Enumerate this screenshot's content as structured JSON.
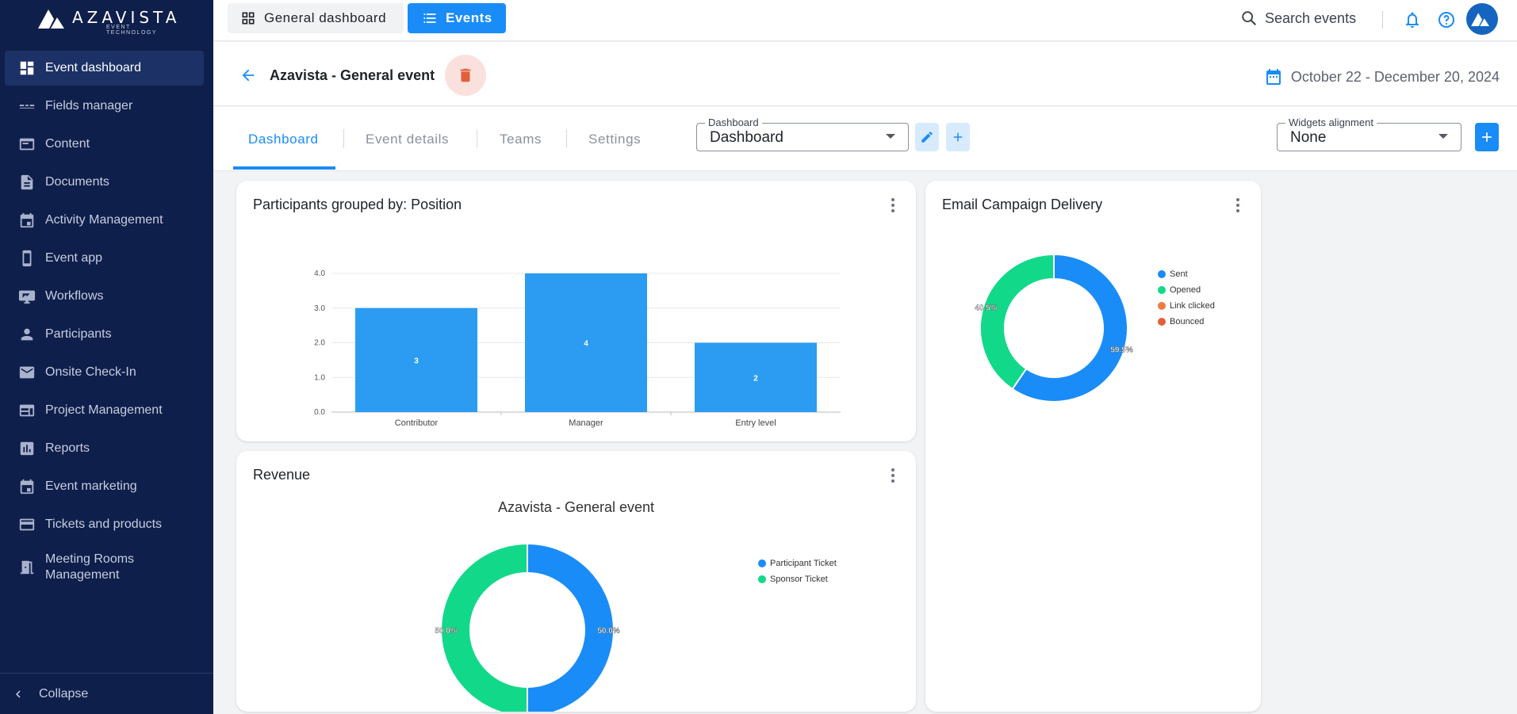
{
  "brand": {
    "name": "AZAVISTA",
    "tagline": "EVENT TECHNOLOGY"
  },
  "sidebar": {
    "items": [
      {
        "label": "Event dashboard",
        "icon": "dashboard-icon",
        "active": true
      },
      {
        "label": "Fields manager",
        "icon": "fields-icon"
      },
      {
        "label": "Content",
        "icon": "content-icon"
      },
      {
        "label": "Documents",
        "icon": "document-icon"
      },
      {
        "label": "Activity Management",
        "icon": "calendar-icon"
      },
      {
        "label": "Event app",
        "icon": "phone-icon"
      },
      {
        "label": "Workflows",
        "icon": "workflow-icon"
      },
      {
        "label": "Participants",
        "icon": "person-icon"
      },
      {
        "label": "Onsite Check-In",
        "icon": "mail-icon"
      },
      {
        "label": "Project Management",
        "icon": "project-icon"
      },
      {
        "label": "Reports",
        "icon": "reports-icon"
      },
      {
        "label": "Event marketing",
        "icon": "calendar-icon"
      },
      {
        "label": "Tickets and products",
        "icon": "card-icon"
      },
      {
        "label": "Meeting Rooms Management",
        "icon": "door-icon"
      }
    ],
    "collapse_label": "Collapse"
  },
  "topbar": {
    "general_label": "General dashboard",
    "events_label": "Events",
    "search_label": "Search events"
  },
  "event": {
    "title": "Azavista - General event",
    "date_range": "October 22 - December 20, 2024"
  },
  "tabs": [
    "Dashboard",
    "Event details",
    "Teams",
    "Settings"
  ],
  "dashboard_select": {
    "label": "Dashboard",
    "value": "Dashboard"
  },
  "alignment_select": {
    "label": "Widgets alignment",
    "value": "None"
  },
  "colors": {
    "accent": "#1a8cf7",
    "green": "#12d989",
    "orange": "#f07b3f",
    "red": "#e0603a",
    "sidebar": "#0f1f4b"
  },
  "widgets": {
    "participants": {
      "title": "Participants grouped by: Position"
    },
    "email": {
      "title": "Email Campaign Delivery"
    },
    "revenue": {
      "title": "Revenue",
      "subtitle": "Azavista - General event"
    }
  },
  "chart_data": [
    {
      "type": "bar",
      "categories": [
        "Contributor",
        "Manager",
        "Entry level"
      ],
      "values": [
        3,
        4,
        2
      ],
      "value_labels": [
        "3",
        "4",
        "2"
      ],
      "yticks": [
        "0.0",
        "1.0",
        "2.0",
        "3.0",
        "4.0"
      ],
      "ylim": [
        0,
        4
      ],
      "grid": true,
      "color": "#2b9cf2"
    },
    {
      "type": "pie",
      "donut": true,
      "labels": [
        "Sent",
        "Opened",
        "Link clicked",
        "Bounced"
      ],
      "values": [
        59.5,
        40.5,
        0,
        0
      ],
      "value_labels": [
        "59.5%",
        "40.5%",
        "",
        ""
      ],
      "colors": [
        "#1a8cf7",
        "#12d989",
        "#f07b3f",
        "#e0603a"
      ],
      "legend": "right"
    },
    {
      "type": "pie",
      "donut": true,
      "title": "Azavista - General event",
      "labels": [
        "Participant Ticket",
        "Sponsor Ticket"
      ],
      "values": [
        50.0,
        50.0
      ],
      "value_labels": [
        "50.0%",
        "50.0%"
      ],
      "colors": [
        "#1a8cf7",
        "#12d989"
      ],
      "legend": "right"
    }
  ]
}
